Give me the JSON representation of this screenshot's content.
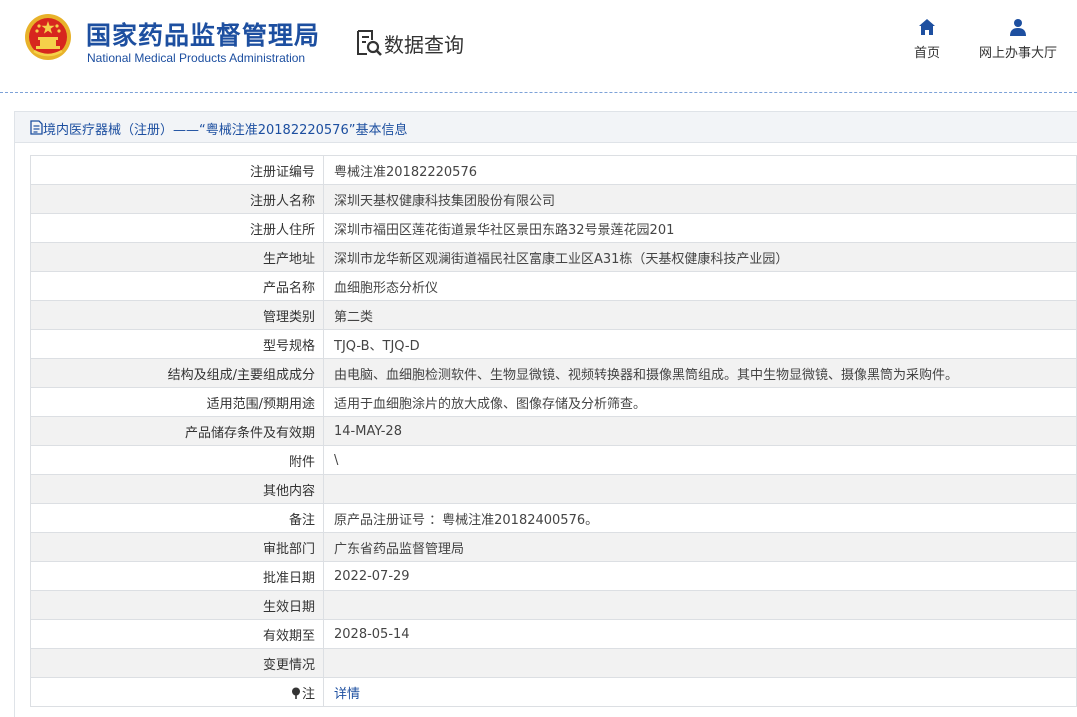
{
  "header": {
    "agency_cn": "国家药品监督管理局",
    "agency_en": "National Medical Products Administration",
    "search_label": "数据查询",
    "nav": [
      {
        "label": "首页",
        "icon": "home-icon"
      },
      {
        "label": "网上办事大厅",
        "icon": "user-icon"
      }
    ]
  },
  "breadcrumb": {
    "text": "境内医疗器械（注册）——“粤械注准20182220576”基本信息"
  },
  "colors": {
    "brand_blue": "#1d4fa0",
    "row_stripe": "#f2f2f2",
    "border": "#dcdfe3"
  },
  "rows": [
    {
      "label": "注册证编号",
      "value": "粤械注准20182220576"
    },
    {
      "label": "注册人名称",
      "value": "深圳天基权健康科技集团股份有限公司"
    },
    {
      "label": "注册人住所",
      "value": "深圳市福田区莲花街道景华社区景田东路32号景莲花园201"
    },
    {
      "label": "生产地址",
      "value": "深圳市龙华新区观澜街道福民社区富康工业区A31栋（天基权健康科技产业园）"
    },
    {
      "label": "产品名称",
      "value": "血细胞形态分析仪"
    },
    {
      "label": "管理类别",
      "value": "第二类"
    },
    {
      "label": "型号规格",
      "value": "TJQ-B、TJQ-D"
    },
    {
      "label": "结构及组成/主要组成成分",
      "value": "由电脑、血细胞检测软件、生物显微镜、视频转换器和摄像黑筒组成。其中生物显微镜、摄像黑筒为采购件。"
    },
    {
      "label": "适用范围/预期用途",
      "value": "适用于血细胞涂片的放大成像、图像存储及分析筛查。"
    },
    {
      "label": "产品储存条件及有效期",
      "value": "14-MAY-28"
    },
    {
      "label": "附件",
      "value": "\\"
    },
    {
      "label": "其他内容",
      "value": ""
    },
    {
      "label": "备注",
      "value": "原产品注册证号 ：粤械注准20182400576。"
    },
    {
      "label": "审批部门",
      "value": "广东省药品监督管理局"
    },
    {
      "label": "批准日期",
      "value": "2022-07-29"
    },
    {
      "label": "生效日期",
      "value": ""
    },
    {
      "label": "有效期至",
      "value": "2028-05-14"
    },
    {
      "label": "变更情况",
      "value": ""
    }
  ],
  "note_row": {
    "label": "注",
    "link": "详情"
  }
}
